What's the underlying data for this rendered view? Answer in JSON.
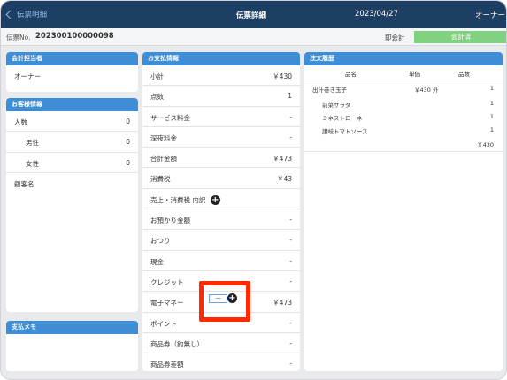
{
  "topbar": {
    "back_label": "伝票明細",
    "title": "伝票詳細",
    "date": "2023/04/27",
    "user": "オーナー"
  },
  "slip": {
    "number_label": "伝票No.",
    "number": "202300100000098",
    "immediate_label": "即会計",
    "status_button": "会計済"
  },
  "accountant": {
    "header": "会計担当者",
    "name": "オーナー"
  },
  "customer": {
    "header": "お客様情報",
    "rows": [
      {
        "label": "人数",
        "value": "0"
      },
      {
        "label": "男性",
        "value": "0"
      },
      {
        "label": "女性",
        "value": "0"
      },
      {
        "label": "顧客名",
        "value": ""
      }
    ]
  },
  "memo": {
    "header": "支払メモ"
  },
  "payment": {
    "header": "お支払情報",
    "rows": [
      {
        "label": "小計",
        "value": "￥430"
      },
      {
        "label": "点数",
        "value": "1"
      },
      {
        "label": "サービス料金",
        "value": "-"
      },
      {
        "label": "深夜料金",
        "value": "-"
      },
      {
        "label": "合計金額",
        "value": "￥473"
      },
      {
        "label": "消費税",
        "value": "￥43"
      },
      {
        "label": "売上・消費税 内訳",
        "value": ""
      },
      {
        "label": "お預かり金額",
        "value": "-"
      },
      {
        "label": "おつり",
        "value": "-"
      },
      {
        "label": "現金",
        "value": "-"
      },
      {
        "label": "クレジット",
        "value": "-"
      },
      {
        "label": "電子マネー",
        "value": "￥473"
      },
      {
        "label": "ポイント",
        "value": "-"
      },
      {
        "label": "商品券（釣無し）",
        "value": "-"
      },
      {
        "label": "商品券差額",
        "value": "-"
      }
    ],
    "emoney_box": "—"
  },
  "orders": {
    "header": "注文履歴",
    "columns": [
      "品名",
      "単価",
      "品数"
    ],
    "main_item": {
      "name": "出汁巻き玉子",
      "price": "￥430 外",
      "qty": "1"
    },
    "sub_items": [
      {
        "name": "前菜サラダ",
        "qty": "1"
      },
      {
        "name": "ミネストローネ",
        "qty": "1"
      },
      {
        "name": "讃岐トマトソース",
        "qty": "1"
      }
    ],
    "total": "￥430"
  },
  "colors": {
    "topbar": "#1d3f63",
    "panel_header": "#3d8ed6",
    "paid_button": "#7fd27f",
    "highlight": "#ff2a00"
  }
}
